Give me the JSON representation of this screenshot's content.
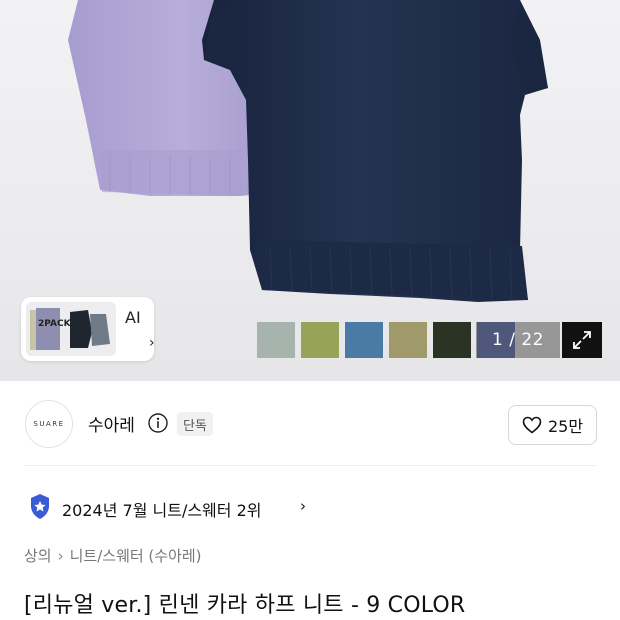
{
  "gallery": {
    "ai_label": "AI",
    "ai_chevron": "›",
    "thumb_text": "2PACK",
    "counter": "1 / 22",
    "swatches": [
      "#a7b3ad",
      "#98a35a",
      "#4a7aa6",
      "#a09a6b",
      "#2b3324",
      "#7a86bc"
    ],
    "expand_icon": "expand-icon"
  },
  "brand": {
    "logo_text": "SUARE",
    "name": "수아레",
    "badge": "단독",
    "likes": "25만"
  },
  "ranking": {
    "text": "2024년 7월 니트/스웨터 2위",
    "chevron": "›"
  },
  "breadcrumb": {
    "items": [
      "상의",
      "니트/스웨터 (수아레)"
    ],
    "separator": "›"
  },
  "product": {
    "title": "[리뉴얼 ver.] 린넨 카라 하프 니트 - 9 COLOR"
  },
  "colors": {
    "lavender_knit": "#b6abd6",
    "navy_knit": "#1e2b47",
    "rank_badge": "#3b5bd6"
  }
}
